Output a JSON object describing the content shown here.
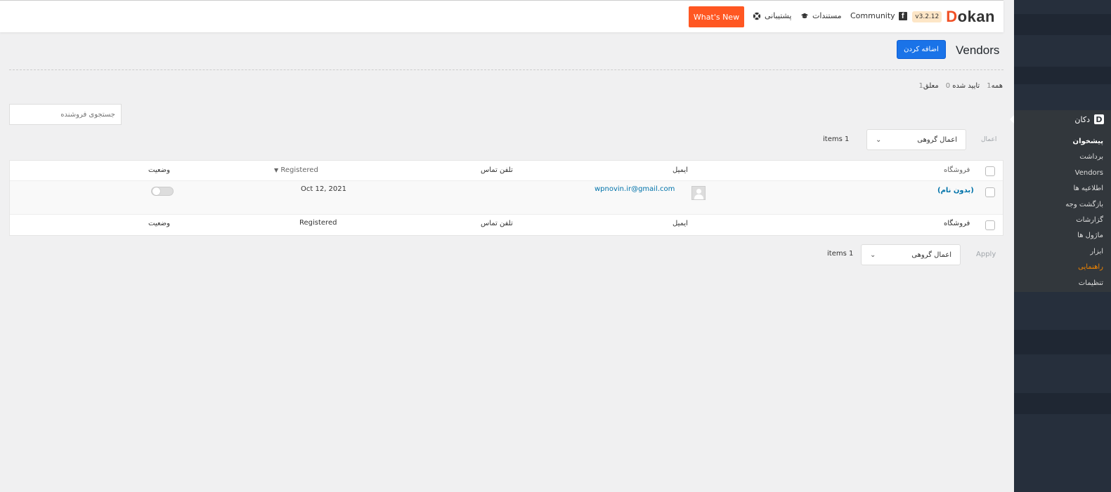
{
  "header": {
    "brand": "Dokan",
    "brand_initial": "D",
    "brand_rest": "okan",
    "version": "v3.2.12",
    "community": "Community",
    "docs": "مستندات",
    "support": "پشتیبانی",
    "whats_new": "What's New"
  },
  "page": {
    "title": "Vendors",
    "add_button": "اضافه کردن"
  },
  "filters": {
    "all_label": "همه",
    "all_count": "1",
    "approved_label": "تایید شده",
    "approved_count": "0",
    "pending_label": "معلق",
    "pending_count": "1"
  },
  "search": {
    "placeholder": "جستجوی فروشنده"
  },
  "bulk_top": {
    "label": "اعمال",
    "select": "اعمال گروهی",
    "items": "items 1"
  },
  "bulk_bottom": {
    "label": "Apply",
    "select": "اعمال گروهی",
    "items": "items 1"
  },
  "table": {
    "columns": {
      "store": "فروشگاه",
      "email": "ایمیل",
      "phone": "تلفن تماس",
      "registered": "Registered",
      "status": "وضعیت"
    },
    "rows": [
      {
        "store": "(بدون نام)",
        "email": "wpnovin.ir@gmail.com",
        "phone": "",
        "registered": "Oct 12, 2021",
        "status_enabled": false
      }
    ]
  },
  "sidebar": {
    "head": "دکان",
    "head_icon": "D",
    "items": [
      {
        "label": "پیشخوان",
        "state": "active"
      },
      {
        "label": "برداشت",
        "state": "normal"
      },
      {
        "label": "Vendors",
        "state": "normal"
      },
      {
        "label": "اطلاعیه ها",
        "state": "normal"
      },
      {
        "label": "بازگشت وجه",
        "state": "normal"
      },
      {
        "label": "گزارشات",
        "state": "normal"
      },
      {
        "label": "ماژول ها",
        "state": "normal"
      },
      {
        "label": "ابزار",
        "state": "normal"
      },
      {
        "label": "راهنمایی",
        "state": "highlight"
      },
      {
        "label": "تنظیمات",
        "state": "normal"
      }
    ]
  },
  "colors": {
    "accent": "#1a73e8",
    "whats_new": "#ff5722",
    "link": "#0073aa",
    "sidebar": "#32373c",
    "highlight": "#f18500"
  }
}
